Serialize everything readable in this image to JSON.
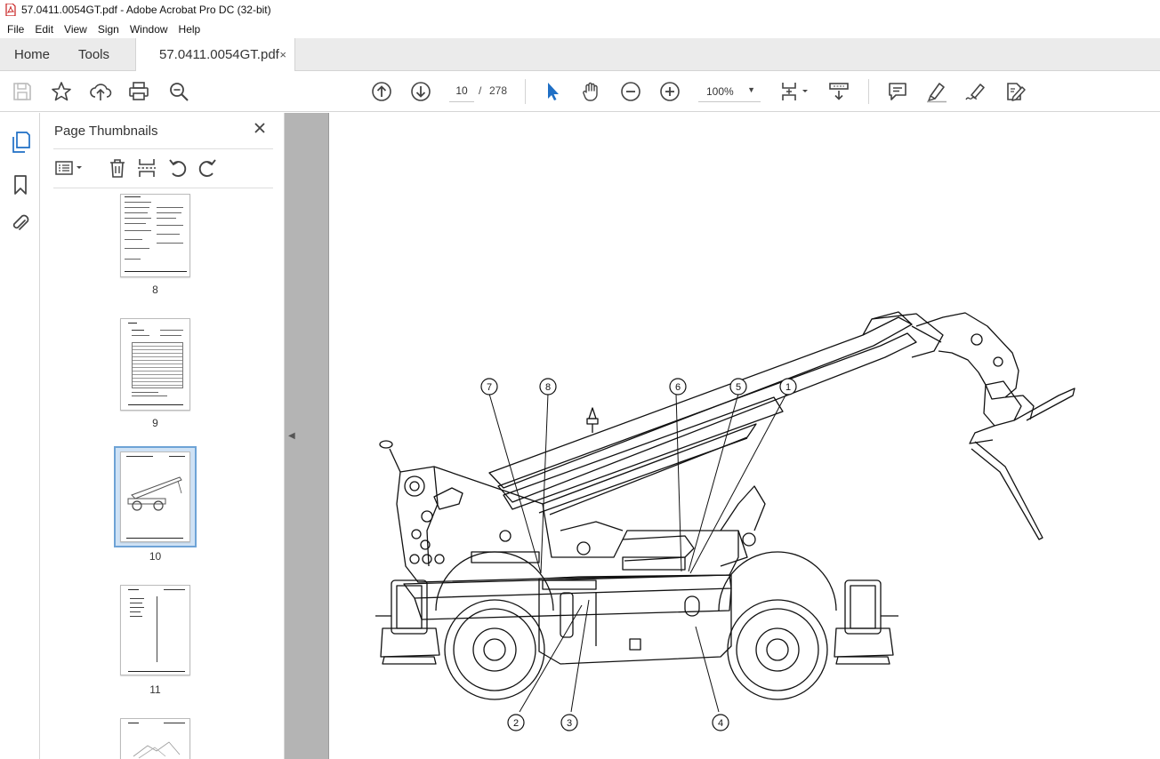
{
  "window": {
    "title": "57.0411.0054GT.pdf - Adobe Acrobat Pro DC (32-bit)",
    "accent": "#c81e1e"
  },
  "menu": [
    "File",
    "Edit",
    "View",
    "Sign",
    "Window",
    "Help"
  ],
  "tabs": {
    "home": "Home",
    "tools": "Tools",
    "document": "57.0411.0054GT.pdf",
    "close_glyph": "×"
  },
  "toolbar": {
    "icons": [
      "save-icon",
      "star-icon",
      "upload-icon",
      "print-icon",
      "zoom-search-icon",
      "page-up-icon",
      "page-down-icon",
      "select-arrow-icon",
      "hand-icon",
      "zoom-out-icon",
      "zoom-in-icon",
      "fit-page-icon",
      "scroll-mode-icon",
      "comment-icon",
      "highlight-icon",
      "sign-icon",
      "edit-pdf-icon"
    ],
    "current_page": "10",
    "page_separator": "/",
    "total_pages": "278",
    "zoom": "100%"
  },
  "thumbnail_panel": {
    "title": "Page Thumbnails",
    "thumbnails": [
      {
        "label": "8"
      },
      {
        "label": "9"
      },
      {
        "label": "10",
        "selected": true
      },
      {
        "label": "11"
      }
    ]
  },
  "document": {
    "callouts": [
      "1",
      "2",
      "3",
      "4",
      "5",
      "6",
      "7",
      "8"
    ]
  }
}
